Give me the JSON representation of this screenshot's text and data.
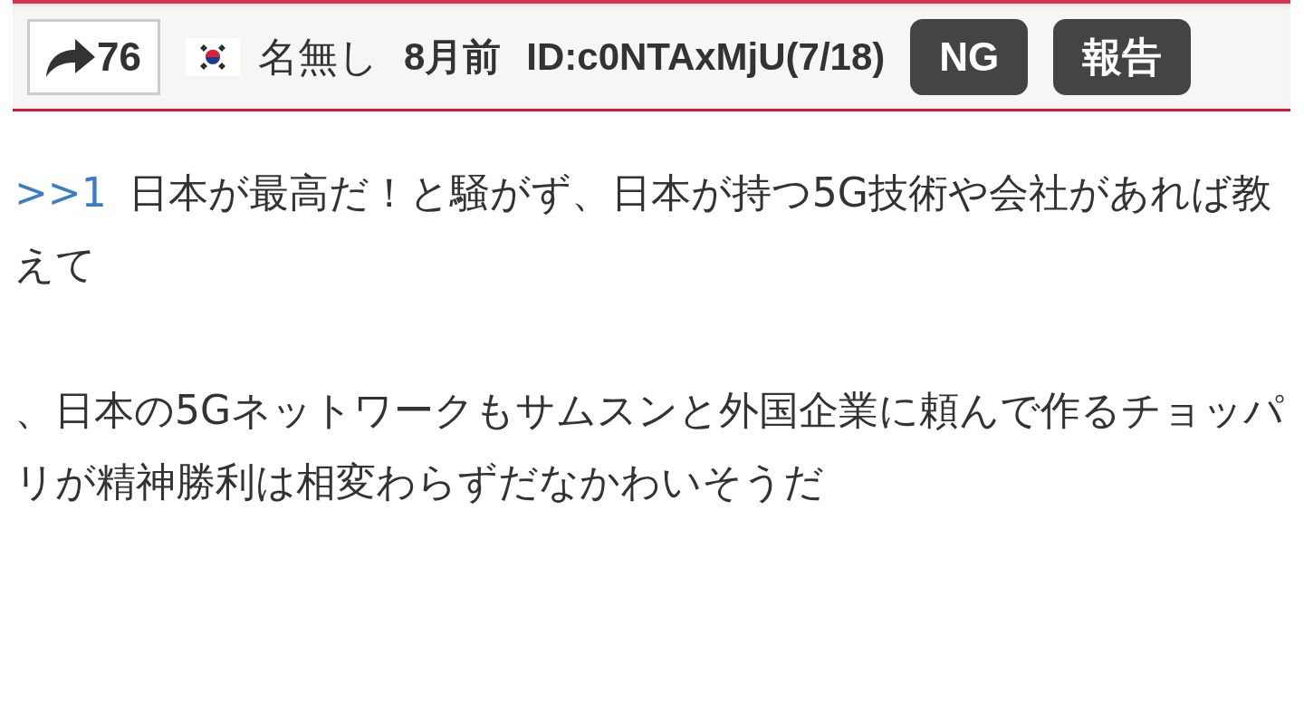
{
  "post_header": {
    "share_count": "76",
    "name": "名無し",
    "age": "8月前",
    "id": "ID:c0NTAxMjU(7/18)",
    "buttons": [
      "NG",
      "報告"
    ]
  },
  "post_body": {
    "reply_link": ">>1",
    "paragraphs": [
      "日本が最高だ！と騒がず、日本が持つ5G技術や会社があれば教えて",
      "、日本の5Gネットワークもサムスンと外国企業に頼んで作るチョッパリが精神勝利は相変わらずだなかわいそうだ"
    ]
  }
}
